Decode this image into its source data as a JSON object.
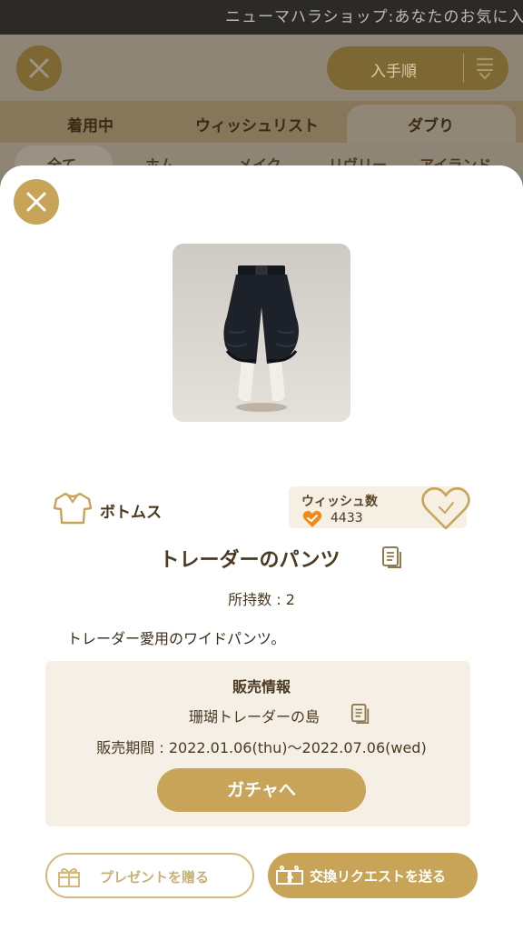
{
  "ticker": {
    "text": "ニューマハラショップ:あなたのお気に入"
  },
  "background": {
    "sort_label": "入手順",
    "tabs": [
      "着用中",
      "ウィッシュリスト",
      "ダブり"
    ],
    "active_tab": "ダブり",
    "chips": [
      "全て",
      "ホム",
      "メイク",
      "リヴリー",
      "アイランド"
    ]
  },
  "item": {
    "category_icon": "shirt-icon",
    "category": "ボトムス",
    "name": "トレーダーのパンツ",
    "owned": "所持数 : 2",
    "description": "トレーダー愛用のワイドパンツ。"
  },
  "wish": {
    "title": "ウィッシュ数",
    "count": "4433"
  },
  "sale": {
    "title": "販売情報",
    "place": "珊瑚トレーダーの島",
    "period": "販売期間 : 2022.01.06(thu)〜2022.07.06(wed)",
    "gacha_button": "ガチャへ"
  },
  "actions": {
    "present_label": "プレゼントを贈る",
    "exchange_label": "交換リクエストを送る"
  },
  "colors": {
    "accent": "#c8a458",
    "text": "#4a3a22",
    "panel": "#f5efe5",
    "heart_orange": "#f08a1c"
  }
}
